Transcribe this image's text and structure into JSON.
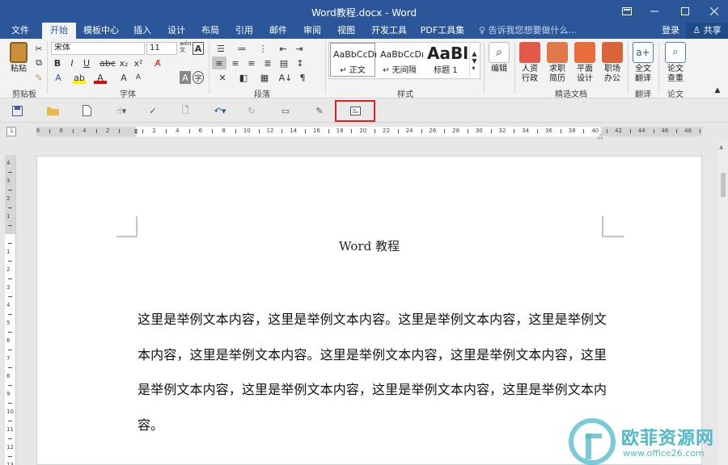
{
  "window": {
    "title": "Word教程.docx - Word",
    "controls": [
      "ribbon-display-icon",
      "minimize-icon",
      "maximize-icon",
      "close-icon"
    ]
  },
  "tabs": [
    {
      "label": "文件",
      "active": false
    },
    {
      "label": "开始",
      "active": true
    },
    {
      "label": "模板中心",
      "active": false
    },
    {
      "label": "插入",
      "active": false
    },
    {
      "label": "设计",
      "active": false
    },
    {
      "label": "布局",
      "active": false
    },
    {
      "label": "引用",
      "active": false
    },
    {
      "label": "邮件",
      "active": false
    },
    {
      "label": "审阅",
      "active": false
    },
    {
      "label": "视图",
      "active": false
    },
    {
      "label": "开发工具",
      "active": false
    },
    {
      "label": "PDF工具集",
      "active": false
    }
  ],
  "tellme": {
    "placeholder": "告诉我您想要做什么..."
  },
  "account": {
    "login": "登录",
    "share": "共享"
  },
  "ribbon": {
    "clipboard": {
      "paste_label": "粘贴",
      "group_label": "剪贴板"
    },
    "font": {
      "name": "宋体",
      "size": "11",
      "group_label": "字体",
      "wen": "wén"
    },
    "paragraph": {
      "group_label": "段落"
    },
    "styles": {
      "group_label": "样式",
      "items": [
        {
          "preview": "AaBbCcDı",
          "name": "↵ 正文"
        },
        {
          "preview": "AaBbCcDı",
          "name": "↵ 无间隔"
        },
        {
          "preview": "AaBl",
          "name": "标题 1"
        }
      ]
    },
    "editing": {
      "label": "编辑"
    },
    "docs": {
      "group_label": "精选文档",
      "items": [
        {
          "line1": "人资",
          "line2": "行政",
          "color": "#e05a47"
        },
        {
          "line1": "求职",
          "line2": "简历",
          "color": "#e0784a"
        },
        {
          "line1": "平面",
          "line2": "设计",
          "color": "#e86c3c"
        },
        {
          "line1": "职场",
          "line2": "办公",
          "color": "#d9643a"
        }
      ]
    },
    "translate": {
      "line1": "全文",
      "line2": "翻译",
      "group_label": "翻译"
    },
    "paper": {
      "line1": "论文",
      "line2": "查重",
      "group_label": "论文"
    }
  },
  "qat": {
    "icons": [
      "save-icon",
      "open-folder-icon",
      "new-doc-icon",
      "touch-mode-icon",
      "spelling-icon",
      "print-preview-icon",
      "undo-icon",
      "redo-icon",
      "screen-icon",
      "edit-icon",
      "insert-textbox-icon"
    ],
    "highlight_color": "#e02020"
  },
  "ruler": {
    "labels": [
      "8",
      "6",
      "4",
      "2",
      "",
      "2",
      "4",
      "6",
      "8",
      "10",
      "12",
      "14",
      "16",
      "18",
      "20",
      "22",
      "24",
      "26",
      "28",
      "30",
      "32",
      "34",
      "36",
      "38",
      "40",
      "42",
      "44",
      "46",
      "48"
    ],
    "vlabels": [
      "4",
      "3",
      "2",
      "1",
      "",
      "1",
      "2",
      "3",
      "4",
      "5",
      "6",
      "7",
      "8",
      "9",
      "10",
      "11",
      "12",
      "13"
    ]
  },
  "document": {
    "title": "Word 教程",
    "body": "这里是举例文本内容，这里是举例文本内容。这里是举例文本内容，这里是举例文本内容，这里是举例文本内容。这里是举例文本内容，这里是举例文本内容，这里是举例文本内容，这里是举例文本内容，这里是举例文本内容，这里是举例文本内容。"
  },
  "watermark": {
    "brand": "欧菲资源网",
    "url": "www.office26.com",
    "color": "#4fb8c9"
  },
  "colors": {
    "accent": "#2b579a",
    "ribbon_bg": "#f3f3f3"
  }
}
